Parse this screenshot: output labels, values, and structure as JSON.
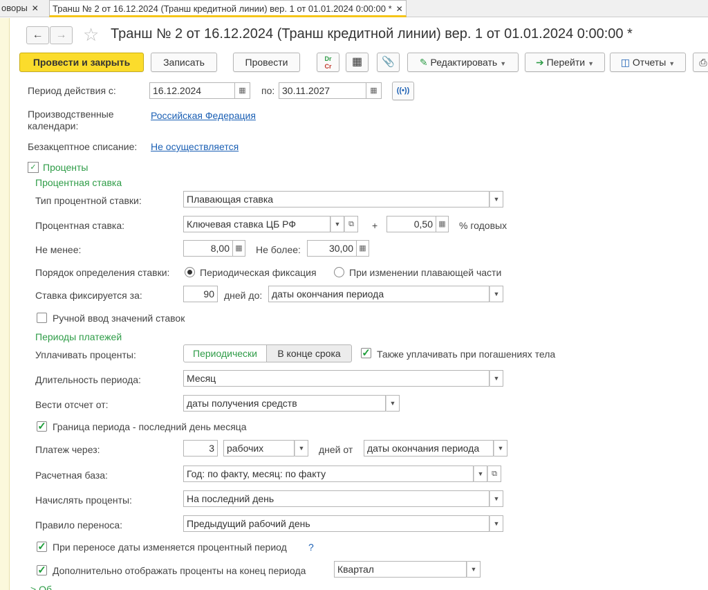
{
  "tabs": [
    {
      "label": "оворы"
    },
    {
      "label": "Транш № 2 от 16.12.2024 (Транш кредитной линии) вер. 1 от 01.01.2024 0:00:00 *"
    }
  ],
  "header": {
    "title": "Транш № 2 от 16.12.2024 (Транш кредитной линии) вер. 1 от 01.01.2024 0:00:00 *"
  },
  "toolbar": {
    "post_close": "Провести и закрыть",
    "save": "Записать",
    "post": "Провести",
    "dtkt_top": "Dr",
    "dtkt_bottom": "Cr",
    "edit": "Редактировать",
    "goto": "Перейти",
    "reports": "Отчеты"
  },
  "period": {
    "label": "Период действия с:",
    "from": "16.12.2024",
    "to_label": "по:",
    "to": "30.11.2027",
    "link_icon": "((•))"
  },
  "calendars": {
    "label_line1": "Производственные",
    "label_line2": "календари:",
    "value": "Российская Федерация"
  },
  "writeoff": {
    "label": "Безакцептное списание:",
    "value": "Не осуществляется"
  },
  "percents": {
    "group_title": "Проценты",
    "rate_section": "Процентная ставка",
    "rate_type_label": "Тип процентной ставки:",
    "rate_type_value": "Плавающая ставка",
    "rate_label": "Процентная ставка:",
    "rate_value": "Ключевая ставка ЦБ РФ",
    "plus": "+",
    "margin_value": "0,50",
    "per_year": "% годовых",
    "min_label": "Не менее:",
    "min_value": "8,00",
    "max_label": "Не более:",
    "max_value": "30,00",
    "order_label": "Порядок определения ставки:",
    "order_opt1": "Периодическая фиксация",
    "order_opt2": "При изменении плавающей части",
    "fix_label": "Ставка фиксируется за:",
    "fix_days": "90",
    "fix_days_before": "дней до:",
    "fix_until": "даты окончания периода",
    "manual_label": "Ручной ввод значений ставок"
  },
  "payments": {
    "section": "Периоды платежей",
    "pay_label": "Уплачивать проценты:",
    "seg_periodic": "Периодически",
    "seg_end": "В конце срока",
    "also_pay_label": "Также уплачивать при погашениях тела",
    "duration_label": "Длительность периода:",
    "duration_value": "Месяц",
    "count_from_label": "Вести отсчет от:",
    "count_from_value": "даты получения средств",
    "boundary_label": "Граница периода - последний день месяца",
    "payment_after_label": "Платеж через:",
    "payment_after_value": "3",
    "payment_day_type": "рабочих",
    "days_from": "дней от",
    "payment_from_value": "даты окончания периода",
    "base_label": "Расчетная база:",
    "base_value": "Год: по факту, месяц: по факту",
    "accrue_label": "Начислять проценты:",
    "accrue_value": "На последний день",
    "transfer_label": "Правило переноса:",
    "transfer_value": "Предыдущий рабочий день",
    "shift_label": "При переносе даты изменяется процентный период",
    "help": "?",
    "extra_label": "Дополнительно отображать проценты на конец периода",
    "extra_value": "Квартал",
    "bottom_partial": "Об"
  },
  "colors": {
    "accent_yellow": "#fbdc2c",
    "green": "#2e9c47",
    "link": "#1a5fb4"
  }
}
